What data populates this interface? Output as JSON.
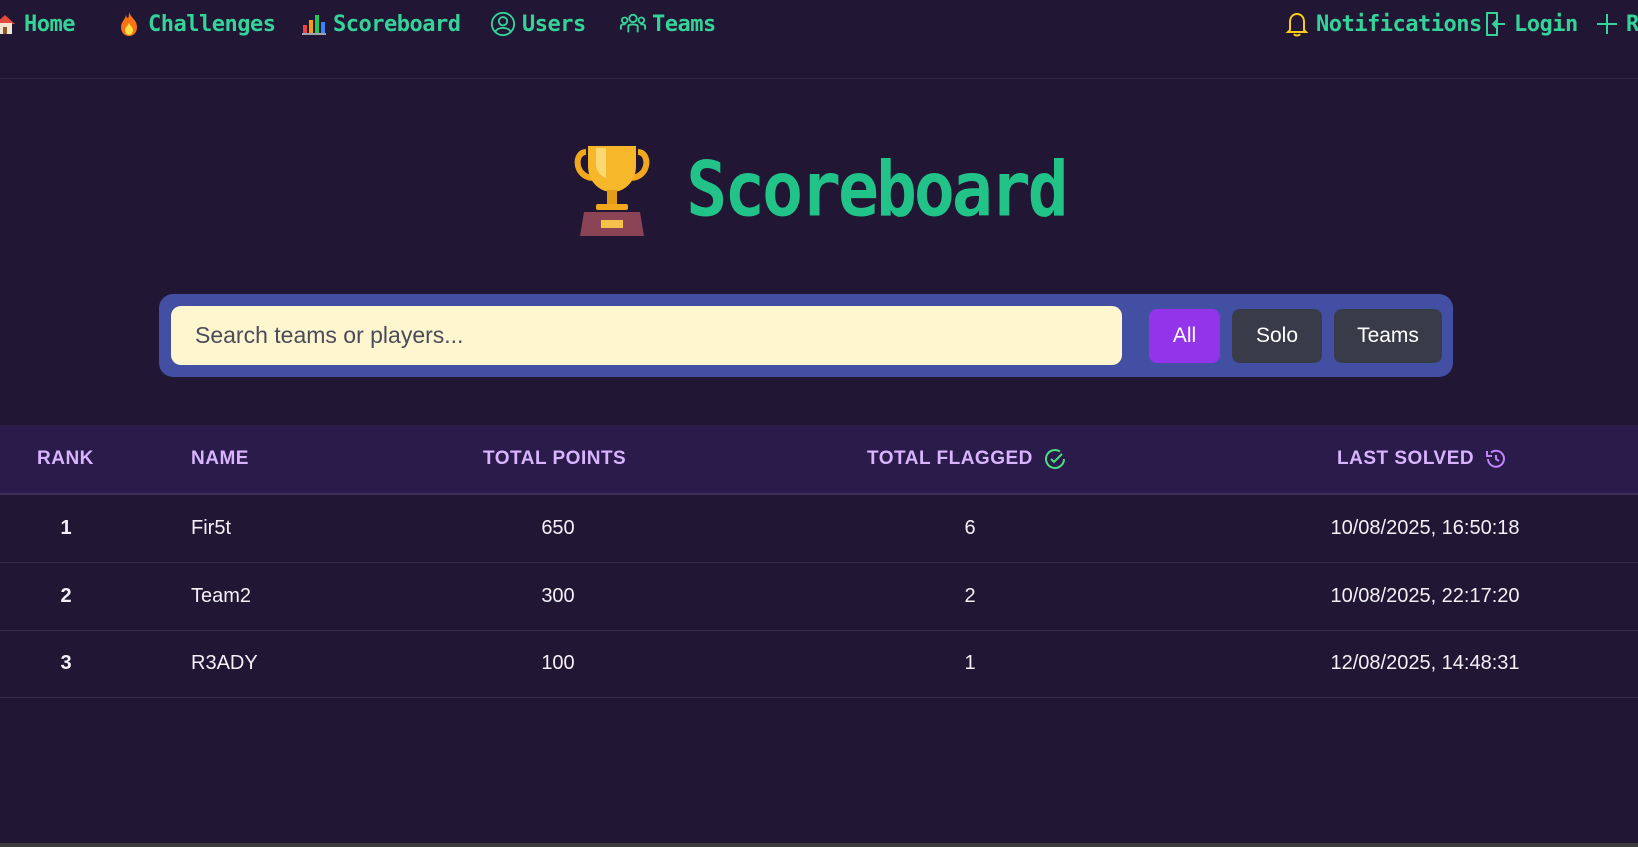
{
  "nav": {
    "home": "Home",
    "challenges": "Challenges",
    "scoreboard": "Scoreboard",
    "users": "Users",
    "teams": "Teams",
    "notifications": "Notifications",
    "login": "Login",
    "register_partial": "R"
  },
  "page": {
    "title": "Scoreboard"
  },
  "search": {
    "placeholder": "Search teams or players...",
    "filters": [
      "All",
      "Solo",
      "Teams"
    ],
    "active_filter": "All"
  },
  "table": {
    "headers": {
      "rank": "RANK",
      "name": "NAME",
      "points": "TOTAL POINTS",
      "flagged": "TOTAL FLAGGED",
      "last_solved": "LAST SOLVED"
    },
    "rows": [
      {
        "rank": "1",
        "name": "Fir5t",
        "points": "650",
        "flagged": "6",
        "last_solved": "10/08/2025, 16:50:18"
      },
      {
        "rank": "2",
        "name": "Team2",
        "points": "300",
        "flagged": "2",
        "last_solved": "10/08/2025, 22:17:20"
      },
      {
        "rank": "3",
        "name": "R3ADY",
        "points": "100",
        "flagged": "1",
        "last_solved": "12/08/2025, 14:48:31"
      }
    ]
  },
  "colors": {
    "background": "#211633",
    "accent_green": "#34d399",
    "purple_active": "#9333ea",
    "header_text": "#d8b4fe",
    "search_panel": "#434fa3",
    "search_field": "#fef6cf"
  },
  "icons": {
    "home": "house-icon",
    "challenges": "fire-icon",
    "scoreboard": "bar-chart-icon",
    "users": "user-circle-icon",
    "teams": "team-icon",
    "notifications": "bell-icon",
    "login": "login-icon",
    "register": "plus-icon",
    "title": "trophy-icon",
    "flagged": "check-circle-icon",
    "last_solved": "history-icon"
  }
}
